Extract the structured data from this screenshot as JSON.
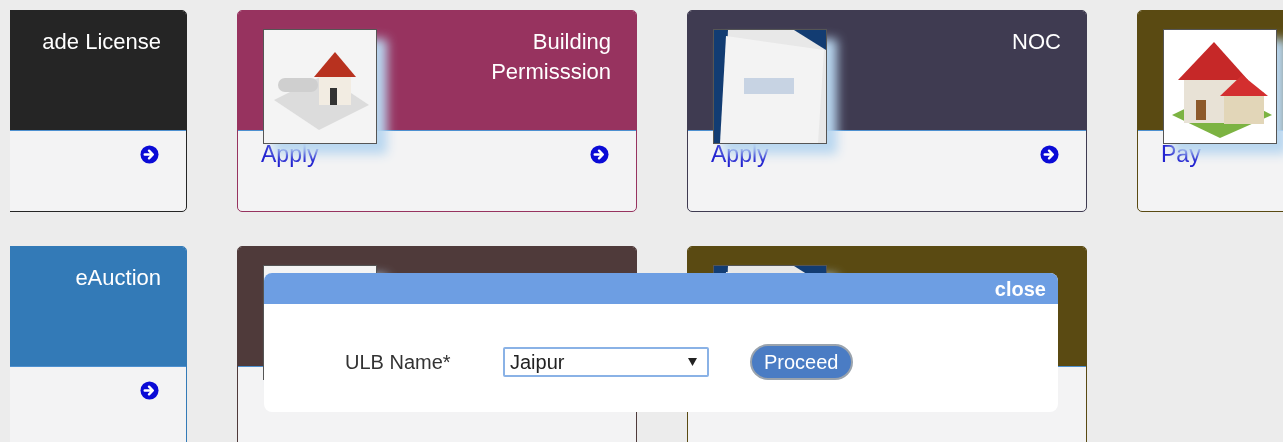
{
  "rows": [
    {
      "cards": [
        {
          "kind": "plain",
          "title": "ade License",
          "color": "#252525",
          "arrow": true
        },
        {
          "kind": "with-picture",
          "title": "Building Permisssion",
          "color": "#97335f",
          "link": "Apply",
          "arrow": true
        },
        {
          "kind": "with-picture",
          "title": "NOC",
          "color": "#3f3b51",
          "link": "Apply",
          "arrow": true
        },
        {
          "kind": "with-picture",
          "color": "#5a4a12",
          "link": "Pay",
          "arrow": false
        }
      ]
    },
    {
      "cards": [
        {
          "kind": "plain",
          "title": "eAuction",
          "color": "#337ab7",
          "arrow": true
        },
        {
          "kind": "with-picture",
          "color": "#4f3a3a",
          "arrow": false
        },
        {
          "kind": "with-picture",
          "color": "#5a4a12",
          "arrow": false
        }
      ]
    }
  ],
  "dialog": {
    "close": "close",
    "label": "ULB Name*",
    "select_value": "Jaipur",
    "button": "Proceed"
  }
}
